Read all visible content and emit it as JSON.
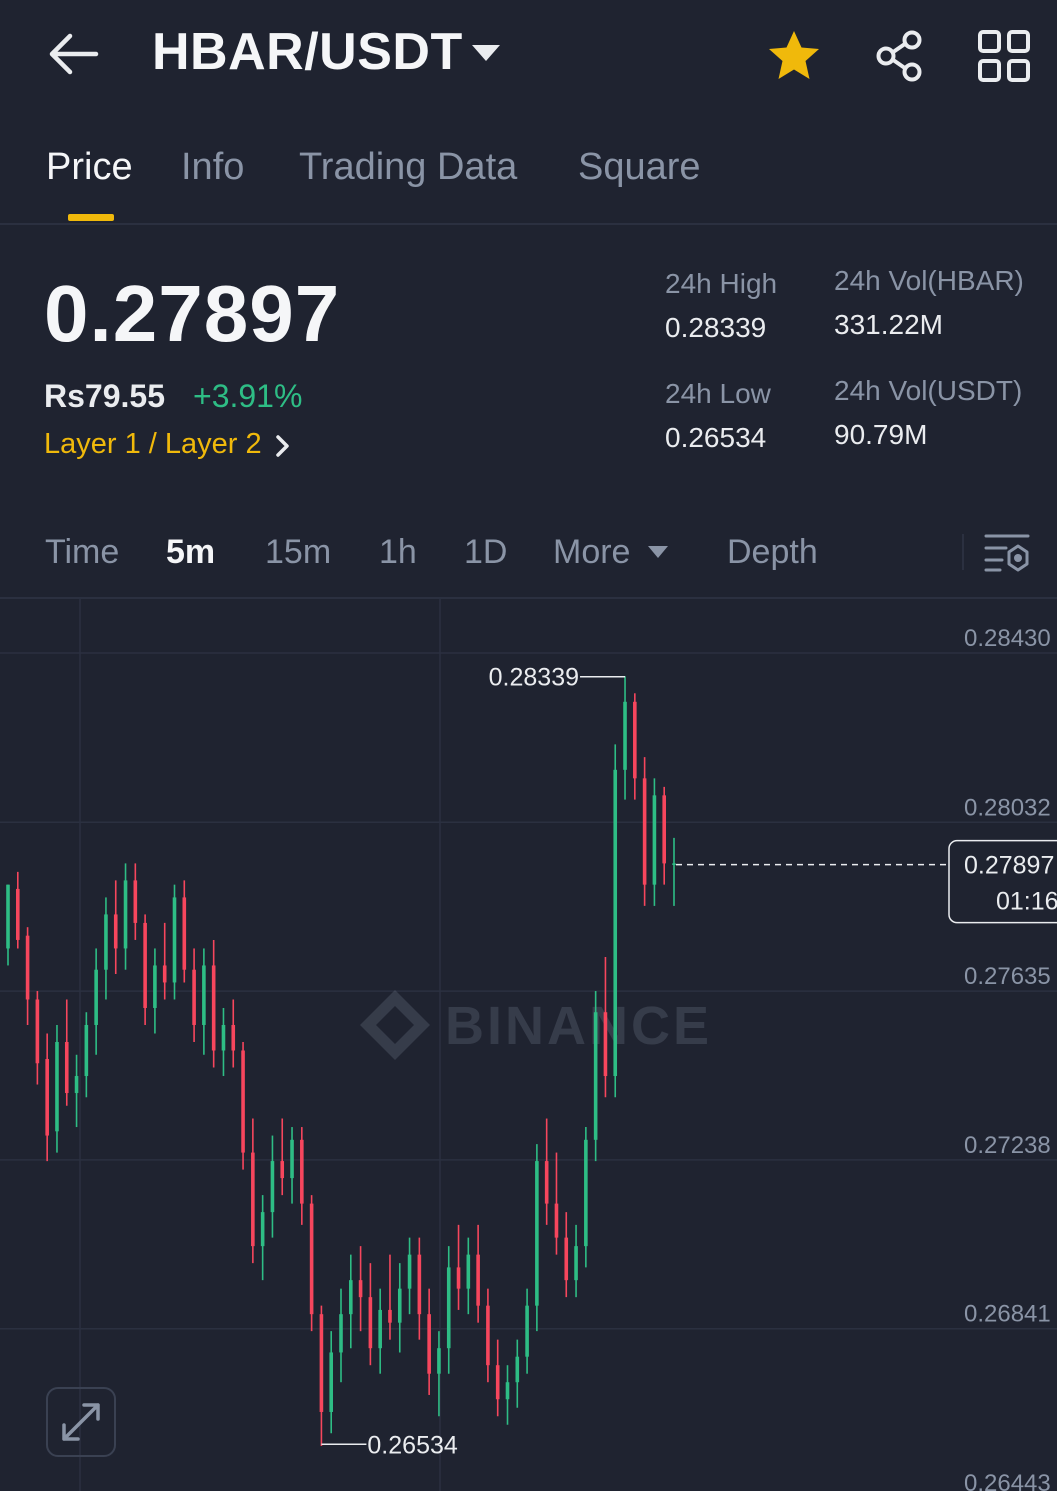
{
  "header": {
    "title": "HBAR/USDT",
    "icons": [
      "back-arrow-icon",
      "dropdown-caret-icon",
      "star-icon",
      "share-icon",
      "grid-icon"
    ],
    "favorite_color": "#f0b90b"
  },
  "tabs": [
    {
      "label": "Price",
      "active": true
    },
    {
      "label": "Info"
    },
    {
      "label": "Trading Data"
    },
    {
      "label": "Square"
    }
  ],
  "ticker": {
    "last_price": "0.27897",
    "fiat_price": "Rs79.55",
    "change": "+3.91%",
    "category": "Layer 1 / Layer 2",
    "stats": {
      "high_label": "24h High",
      "high_value": "0.28339",
      "low_label": "24h Low",
      "low_value": "0.26534",
      "vol_base_label": "24h Vol(HBAR)",
      "vol_base_value": "331.22M",
      "vol_quote_label": "24h Vol(USDT)",
      "vol_quote_value": "90.79M"
    }
  },
  "intervals": [
    {
      "label": "Time"
    },
    {
      "label": "5m",
      "active": true
    },
    {
      "label": "15m"
    },
    {
      "label": "1h"
    },
    {
      "label": "1D"
    },
    {
      "label": "More"
    },
    {
      "label": "Depth"
    }
  ],
  "colors": {
    "up": "#2ebd85",
    "down": "#f6465d",
    "accent": "#f0b90b",
    "background": "#1f2330"
  },
  "chart_data": {
    "type": "candlestick",
    "watermark": "BINANCE",
    "y_ticks": [
      "0.28430",
      "0.28032",
      "0.27635",
      "0.27238",
      "0.26841",
      "0.26443"
    ],
    "ylim": [
      0.26443,
      0.2843
    ],
    "high_marker": "0.28339",
    "low_marker": "0.26534",
    "last_price_tag": {
      "price": "0.27897",
      "countdown": "01:16"
    },
    "candles": [
      [
        0.277,
        0.2785,
        0.2766,
        0.2785
      ],
      [
        0.2784,
        0.2788,
        0.277,
        0.2772
      ],
      [
        0.2773,
        0.2775,
        0.2752,
        0.2758
      ],
      [
        0.2758,
        0.276,
        0.2738,
        0.2743
      ],
      [
        0.2744,
        0.275,
        0.272,
        0.2726
      ],
      [
        0.2727,
        0.2752,
        0.2722,
        0.2748
      ],
      [
        0.2748,
        0.2758,
        0.2733,
        0.2736
      ],
      [
        0.2736,
        0.2745,
        0.2728,
        0.274
      ],
      [
        0.274,
        0.2755,
        0.2735,
        0.2752
      ],
      [
        0.2752,
        0.277,
        0.2745,
        0.2765
      ],
      [
        0.2765,
        0.2782,
        0.2758,
        0.2778
      ],
      [
        0.2778,
        0.2786,
        0.2764,
        0.277
      ],
      [
        0.277,
        0.279,
        0.2765,
        0.2786
      ],
      [
        0.2786,
        0.279,
        0.2772,
        0.2776
      ],
      [
        0.2776,
        0.2778,
        0.2752,
        0.2756
      ],
      [
        0.2756,
        0.277,
        0.275,
        0.2766
      ],
      [
        0.2766,
        0.2776,
        0.2758,
        0.2762
      ],
      [
        0.2762,
        0.2785,
        0.2758,
        0.2782
      ],
      [
        0.2782,
        0.2786,
        0.2762,
        0.2765
      ],
      [
        0.2765,
        0.277,
        0.2748,
        0.2752
      ],
      [
        0.2752,
        0.277,
        0.2745,
        0.2766
      ],
      [
        0.2766,
        0.2772,
        0.2742,
        0.2746
      ],
      [
        0.2746,
        0.2756,
        0.274,
        0.2752
      ],
      [
        0.2752,
        0.2758,
        0.2742,
        0.2746
      ],
      [
        0.2746,
        0.2748,
        0.2718,
        0.2722
      ],
      [
        0.2722,
        0.273,
        0.2696,
        0.27
      ],
      [
        0.27,
        0.2712,
        0.2692,
        0.2708
      ],
      [
        0.2708,
        0.2726,
        0.2702,
        0.272
      ],
      [
        0.272,
        0.273,
        0.2712,
        0.2716
      ],
      [
        0.2716,
        0.2728,
        0.271,
        0.2725
      ],
      [
        0.2725,
        0.2728,
        0.2705,
        0.271
      ],
      [
        0.271,
        0.2712,
        0.268,
        0.2684
      ],
      [
        0.2684,
        0.2686,
        0.2653,
        0.2661
      ],
      [
        0.2661,
        0.268,
        0.2656,
        0.2675
      ],
      [
        0.2675,
        0.269,
        0.2668,
        0.2684
      ],
      [
        0.2684,
        0.2698,
        0.2676,
        0.2692
      ],
      [
        0.2692,
        0.27,
        0.268,
        0.2688
      ],
      [
        0.2688,
        0.2696,
        0.2672,
        0.2676
      ],
      [
        0.2676,
        0.269,
        0.267,
        0.2685
      ],
      [
        0.2685,
        0.2698,
        0.2678,
        0.2682
      ],
      [
        0.2682,
        0.2696,
        0.2675,
        0.269
      ],
      [
        0.269,
        0.2702,
        0.2684,
        0.2698
      ],
      [
        0.2698,
        0.2702,
        0.2678,
        0.2684
      ],
      [
        0.2684,
        0.269,
        0.2665,
        0.267
      ],
      [
        0.267,
        0.268,
        0.266,
        0.2676
      ],
      [
        0.2676,
        0.27,
        0.267,
        0.2695
      ],
      [
        0.2695,
        0.2705,
        0.2685,
        0.269
      ],
      [
        0.269,
        0.2702,
        0.2684,
        0.2698
      ],
      [
        0.2698,
        0.2705,
        0.2682,
        0.2686
      ],
      [
        0.2686,
        0.269,
        0.2668,
        0.2672
      ],
      [
        0.2672,
        0.2678,
        0.266,
        0.2664
      ],
      [
        0.2664,
        0.2672,
        0.2658,
        0.2668
      ],
      [
        0.2668,
        0.2678,
        0.2662,
        0.2674
      ],
      [
        0.2674,
        0.269,
        0.267,
        0.2686
      ],
      [
        0.2686,
        0.2724,
        0.268,
        0.272
      ],
      [
        0.272,
        0.273,
        0.2705,
        0.271
      ],
      [
        0.271,
        0.2722,
        0.2698,
        0.2702
      ],
      [
        0.2702,
        0.2708,
        0.2688,
        0.2692
      ],
      [
        0.2692,
        0.2705,
        0.2688,
        0.27
      ],
      [
        0.27,
        0.2728,
        0.2695,
        0.2725
      ],
      [
        0.2725,
        0.276,
        0.272,
        0.2755
      ],
      [
        0.2755,
        0.2768,
        0.2735,
        0.274
      ],
      [
        0.274,
        0.2818,
        0.2735,
        0.2812
      ],
      [
        0.2812,
        0.2834,
        0.2805,
        0.2828
      ],
      [
        0.2828,
        0.283,
        0.2805,
        0.281
      ],
      [
        0.281,
        0.2815,
        0.278,
        0.2785
      ],
      [
        0.2785,
        0.281,
        0.278,
        0.2806
      ],
      [
        0.2806,
        0.2808,
        0.2785,
        0.279
      ],
      [
        0.279,
        0.2796,
        0.278,
        0.279
      ]
    ]
  }
}
